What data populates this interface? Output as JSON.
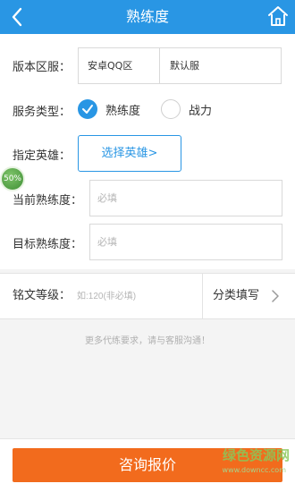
{
  "header": {
    "title": "熟练度"
  },
  "form": {
    "zone_label": "版本区服：",
    "zone_version": "安卓QQ区",
    "zone_server": "默认服",
    "service_label": "服务类型：",
    "service_options": [
      {
        "label": "熟练度",
        "selected": true
      },
      {
        "label": "战力",
        "selected": false
      }
    ],
    "hero_label": "指定英雄：",
    "hero_button": "选择英雄>",
    "current_label": "当前熟练度：",
    "current_placeholder": "必填",
    "target_label": "目标熟练度：",
    "target_placeholder": "必填"
  },
  "overlay_badge": "50%",
  "rune": {
    "label": "铭文等级：",
    "placeholder": "如:120(非必填)",
    "category_button": "分类填写"
  },
  "note": "更多代练要求，请与客服沟通！",
  "footer": {
    "consult_button": "咨询报价",
    "watermark": "绿色资源网",
    "watermark_url": "www.downcc.com"
  },
  "colors": {
    "accent": "#2996e4",
    "cta": "#f26b1d"
  },
  "icons": {
    "back": "back-arrow-icon",
    "home": "home-icon",
    "check": "checkmark-icon",
    "chevron": "chevron-right-icon"
  }
}
